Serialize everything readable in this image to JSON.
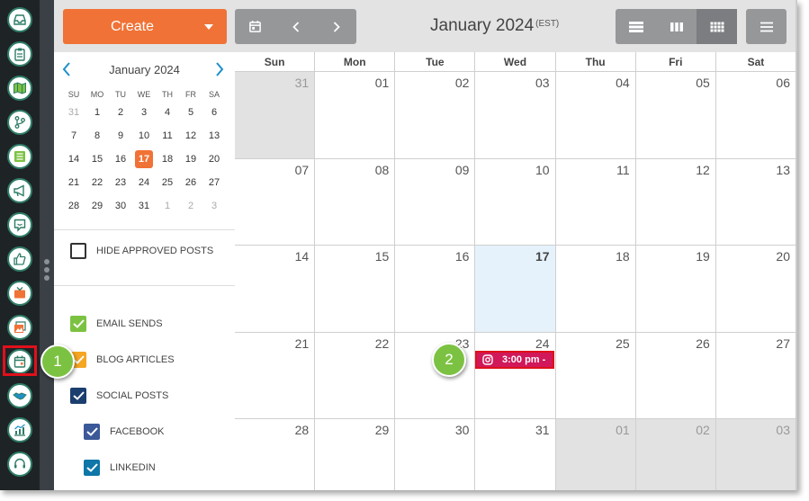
{
  "toolbar": {
    "create_label": "Create",
    "month_title": "January 2024",
    "timezone": "(EST)"
  },
  "mini_calendar": {
    "title": "January 2024",
    "weekdays": [
      "SU",
      "MO",
      "TU",
      "WE",
      "TH",
      "FR",
      "SA"
    ],
    "weeks": [
      [
        "31",
        "1",
        "2",
        "3",
        "4",
        "5",
        "6"
      ],
      [
        "7",
        "8",
        "9",
        "10",
        "11",
        "12",
        "13"
      ],
      [
        "14",
        "15",
        "16",
        "17",
        "18",
        "19",
        "20"
      ],
      [
        "21",
        "22",
        "23",
        "24",
        "25",
        "26",
        "27"
      ],
      [
        "28",
        "29",
        "30",
        "31",
        "1",
        "2",
        "3"
      ]
    ],
    "today": "17"
  },
  "filters": {
    "hide_approved": "HIDE APPROVED POSTS",
    "email_sends": "EMAIL SENDS",
    "blog_articles": "BLOG ARTICLES",
    "social_posts": "SOCIAL POSTS",
    "facebook": "FACEBOOK",
    "linkedin": "LINKEDIN"
  },
  "colors": {
    "accent": "#f07236",
    "email": "#7cc242",
    "blog": "#f5a623",
    "social": "#1a3e6e",
    "facebook": "#3b5998",
    "linkedin": "#0e76a8",
    "event": "#d0185a",
    "highlight": "#e0101a"
  },
  "calendar": {
    "weekdays": [
      "Sun",
      "Mon",
      "Tue",
      "Wed",
      "Thu",
      "Fri",
      "Sat"
    ],
    "weeks": [
      [
        "31",
        "01",
        "02",
        "03",
        "04",
        "05",
        "06"
      ],
      [
        "07",
        "08",
        "09",
        "10",
        "11",
        "12",
        "13"
      ],
      [
        "14",
        "15",
        "16",
        "17",
        "18",
        "19",
        "20"
      ],
      [
        "21",
        "22",
        "23",
        "24",
        "25",
        "26",
        "27"
      ],
      [
        "28",
        "29",
        "30",
        "31",
        "01",
        "02",
        "03"
      ]
    ],
    "event_label": "3:00 pm -"
  },
  "markers": {
    "one": "1",
    "two": "2"
  }
}
